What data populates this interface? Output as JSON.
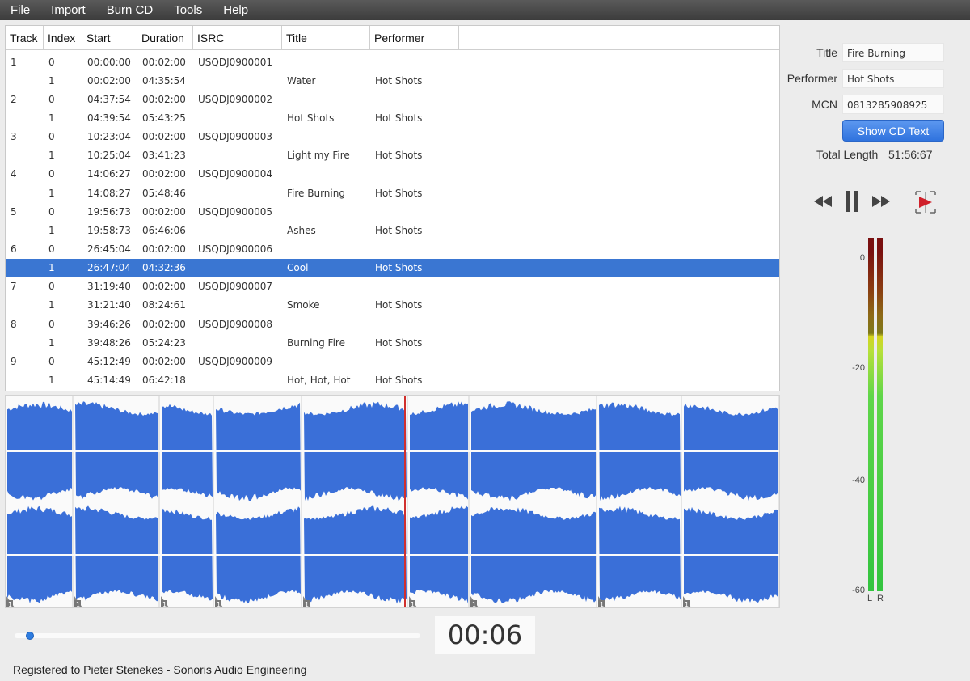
{
  "menu": [
    "File",
    "Import",
    "Burn CD",
    "Tools",
    "Help"
  ],
  "table": {
    "headers": [
      "Track",
      "Index",
      "Start",
      "Duration",
      "ISRC",
      "Title",
      "Performer"
    ],
    "rows": [
      [
        "1",
        "0",
        "00:00:00",
        "00:02:00",
        "USQDJ0900001",
        "",
        ""
      ],
      [
        "",
        "1",
        "00:02:00",
        "04:35:54",
        "",
        "Water",
        "Hot Shots"
      ],
      [
        "2",
        "0",
        "04:37:54",
        "00:02:00",
        "USQDJ0900002",
        "",
        ""
      ],
      [
        "",
        "1",
        "04:39:54",
        "05:43:25",
        "",
        "Hot Shots",
        "Hot Shots"
      ],
      [
        "3",
        "0",
        "10:23:04",
        "00:02:00",
        "USQDJ0900003",
        "",
        ""
      ],
      [
        "",
        "1",
        "10:25:04",
        "03:41:23",
        "",
        "Light my Fire",
        "Hot Shots"
      ],
      [
        "4",
        "0",
        "14:06:27",
        "00:02:00",
        "USQDJ0900004",
        "",
        ""
      ],
      [
        "",
        "1",
        "14:08:27",
        "05:48:46",
        "",
        "Fire Burning",
        "Hot Shots"
      ],
      [
        "5",
        "0",
        "19:56:73",
        "00:02:00",
        "USQDJ0900005",
        "",
        ""
      ],
      [
        "",
        "1",
        "19:58:73",
        "06:46:06",
        "",
        "Ashes",
        "Hot Shots"
      ],
      [
        "6",
        "0",
        "26:45:04",
        "00:02:00",
        "USQDJ0900006",
        "",
        ""
      ],
      [
        "",
        "1",
        "26:47:04",
        "04:32:36",
        "",
        "Cool",
        "Hot Shots"
      ],
      [
        "7",
        "0",
        "31:19:40",
        "00:02:00",
        "USQDJ0900007",
        "",
        ""
      ],
      [
        "",
        "1",
        "31:21:40",
        "08:24:61",
        "",
        "Smoke",
        "Hot Shots"
      ],
      [
        "8",
        "0",
        "39:46:26",
        "00:02:00",
        "USQDJ0900008",
        "",
        ""
      ],
      [
        "",
        "1",
        "39:48:26",
        "05:24:23",
        "",
        "Burning Fire",
        "Hot Shots"
      ],
      [
        "9",
        "0",
        "45:12:49",
        "00:02:00",
        "USQDJ0900009",
        "",
        ""
      ],
      [
        "",
        "1",
        "45:14:49",
        "06:42:18",
        "",
        "Hot, Hot, Hot",
        "Hot Shots"
      ]
    ],
    "selected_row": 11
  },
  "waveform": {
    "index_marker_label": "1",
    "color": "#3a6fd8",
    "playhead_color": "#d0302e"
  },
  "transport": {
    "time": "00:06",
    "position_fraction": 0.02
  },
  "cd_info": {
    "title_label": "Title",
    "title_value": "Fire Burning",
    "performer_label": "Performer",
    "performer_value": "Hot Shots",
    "mcn_label": "MCN",
    "mcn_value": "0813285908925",
    "show_cd_text_label": "Show CD Text",
    "total_length_label": "Total Length",
    "total_length_value": "51:56:67"
  },
  "controls": [
    "rewind-icon",
    "pause-icon",
    "fast-forward-icon",
    "play-selection-icon"
  ],
  "meter": {
    "ticks": [
      "0",
      "-20",
      "-40",
      "-60"
    ],
    "channels": [
      "L",
      "R"
    ],
    "level_db_L": -15,
    "level_db_R": -15
  },
  "status_text": "Registered to Pieter Stenekes - Sonoris Audio Engineering"
}
